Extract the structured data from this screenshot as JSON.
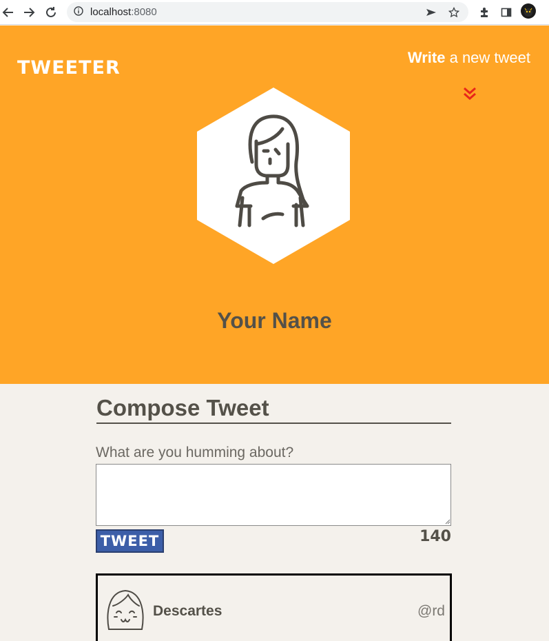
{
  "browser": {
    "url_host": "localhost",
    "url_port": ":8080"
  },
  "header": {
    "logo": "TWEETER",
    "write_bold": "Write",
    "write_rest": " a new tweet",
    "profile_name": "Your Name",
    "accent_color": "#ffa526"
  },
  "compose": {
    "title": "Compose Tweet",
    "prompt": "What are you humming about?",
    "textarea_value": "",
    "button_label": "TWEET",
    "counter": "140",
    "button_color": "#3c5ea8"
  },
  "tweets": [
    {
      "name": "Descartes",
      "handle": "@rd"
    }
  ],
  "icons": [
    "back-arrow-icon",
    "forward-arrow-icon",
    "reload-icon",
    "info-icon",
    "send-icon",
    "star-icon",
    "extensions-icon",
    "sidebar-icon",
    "profile-icon",
    "double-chevron-down-icon",
    "avatar-illustration",
    "smiling-avatar-icon"
  ]
}
